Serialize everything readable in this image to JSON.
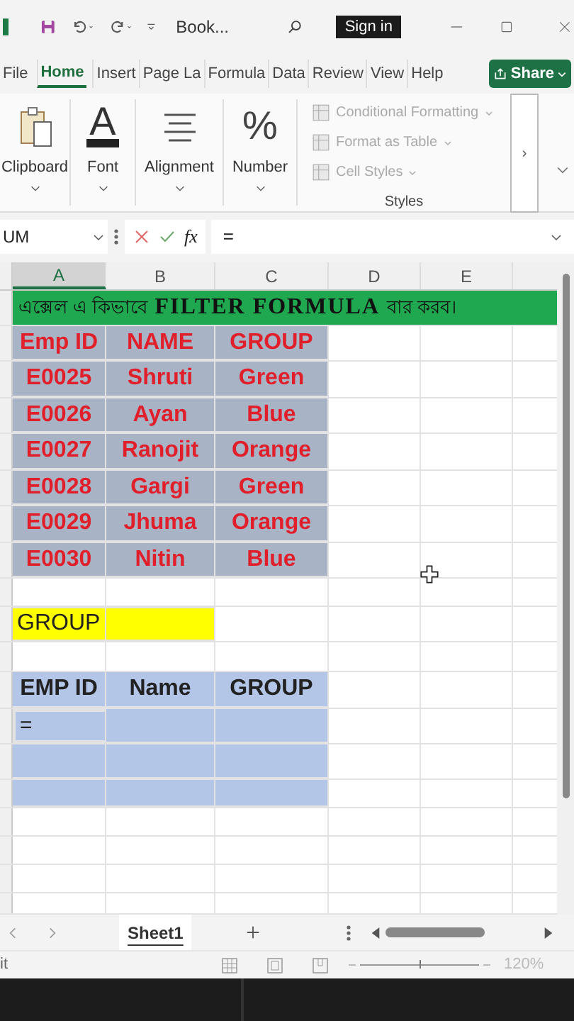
{
  "title_bar": {
    "title": "Book...",
    "sign_in": "Sign in"
  },
  "ribbon_tabs": [
    {
      "label": "File",
      "selected": false
    },
    {
      "label": "Home",
      "selected": true
    },
    {
      "label": "Insert",
      "selected": false
    },
    {
      "label": "Page La",
      "selected": false
    },
    {
      "label": "Formula",
      "selected": false
    },
    {
      "label": "Data",
      "selected": false
    },
    {
      "label": "Review",
      "selected": false
    },
    {
      "label": "View",
      "selected": false
    },
    {
      "label": "Help",
      "selected": false
    }
  ],
  "share_button": "Share",
  "ribbon_groups": [
    {
      "kind": "clipboard",
      "label": "Clipboard"
    },
    {
      "kind": "font",
      "label": "Font",
      "glyph": "A"
    },
    {
      "kind": "alignment",
      "label": "Alignment"
    },
    {
      "kind": "number",
      "label": "Number",
      "glyph": "%"
    }
  ],
  "styles_group": {
    "items": [
      "Conditional Formatting",
      "Format as Table",
      "Cell Styles"
    ],
    "label": "Styles",
    "more": "›"
  },
  "formula_bar": {
    "name_box": "UM",
    "function_label": "fx",
    "value": "="
  },
  "column_headers": [
    {
      "label": "A",
      "selected": true
    },
    {
      "label": "B",
      "selected": false
    },
    {
      "label": "C",
      "selected": false
    },
    {
      "label": "D",
      "selected": false
    },
    {
      "label": "E",
      "selected": false
    }
  ],
  "banner": "এক্সেল এ কিভাবে **FILTER FORMULA** বার করব।",
  "data_table": {
    "columns": [
      "Emp ID",
      "NAME",
      "GROUP"
    ],
    "rows": [
      [
        "E0025",
        "Shruti",
        "Green"
      ],
      [
        "E0026",
        "Ayan",
        "Blue"
      ],
      [
        "E0027",
        "Ranojit",
        "Orange"
      ],
      [
        "E0028",
        "Gargi",
        "Green"
      ],
      [
        "E0029",
        "Jhuma",
        "Orange"
      ],
      [
        "E0030",
        "Nitin",
        "Blue"
      ]
    ]
  },
  "criteria": {
    "label": "GROUP"
  },
  "result_table": {
    "columns": [
      "EMP ID",
      "Name",
      "GROUP"
    ],
    "editing_value": "="
  },
  "sheet_tabs": [
    {
      "label": "Sheet1",
      "selected": true
    }
  ],
  "status_bar": {
    "mode": "it",
    "zoom": "120%"
  },
  "zoom_slider": {
    "level": 0.5
  }
}
